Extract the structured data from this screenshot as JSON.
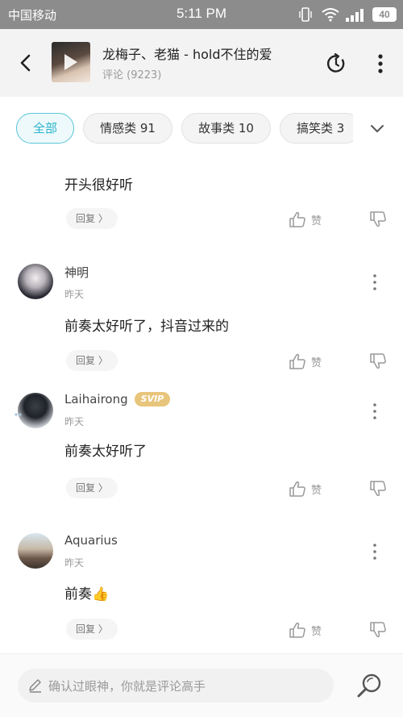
{
  "status_bar": {
    "carrier": "中国移动",
    "time": "5:11 PM",
    "battery": "40"
  },
  "header": {
    "song_title": "龙梅子、老猫 - hold不住的爱",
    "comment_count": "评论 (9223)"
  },
  "filters": {
    "tabs": [
      {
        "label": "全部",
        "active": true
      },
      {
        "label": "情感类 91",
        "active": false
      },
      {
        "label": "故事类 10",
        "active": false
      },
      {
        "label": "搞笑类 3",
        "active": false
      }
    ]
  },
  "comments": [
    {
      "username": "",
      "date": "",
      "text": "开头很好听",
      "reply_label": "回复 〉",
      "like_label": "赞"
    },
    {
      "username": "神明",
      "date": "昨天",
      "text": "前奏太好听了，抖音过来的",
      "reply_label": "回复 〉",
      "like_label": "赞"
    },
    {
      "username": "Laihairong",
      "badge": "SVIP",
      "date": "昨天",
      "text": "前奏太好听了",
      "reply_label": "回复 〉",
      "like_label": "赞"
    },
    {
      "username": "Aquarius",
      "date": "昨天",
      "text": "前奏👍",
      "reply_label": "回复 〉",
      "like_label": "赞"
    }
  ],
  "input": {
    "placeholder": "确认过眼神，你就是评论高手"
  },
  "colors": {
    "accent": "#2ab4cc",
    "svip_gold": "#e8c57c",
    "status_bar": "#8c8c8c"
  },
  "icons": [
    "back-arrow-icon",
    "play-icon",
    "refresh-icon",
    "more-vertical-icon",
    "chevron-down-icon",
    "thumb-up-icon",
    "thumb-down-icon",
    "pen-icon",
    "search-icon"
  ]
}
